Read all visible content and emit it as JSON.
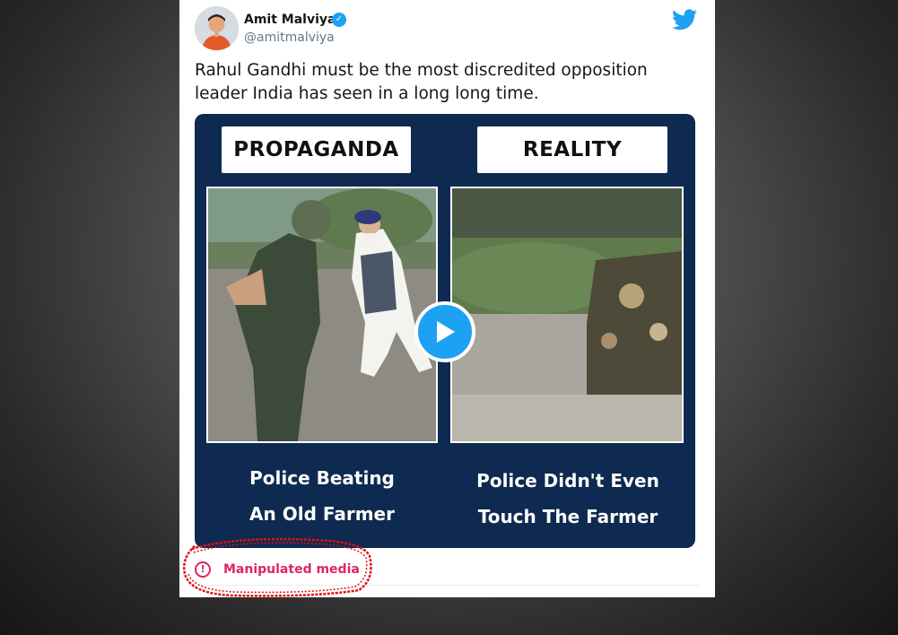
{
  "tweet": {
    "author_name": "Amit Malviya",
    "author_handle": "@amitmalviya",
    "text": "Rahul Gandhi must be the most discredited opposition leader India has seen in a long long time.",
    "verified": true
  },
  "media": {
    "left_label": "PROPAGANDA",
    "right_label": "REALITY",
    "left_caption_line1": "Police Beating",
    "left_caption_line2": "An Old Farmer",
    "right_caption_line1": "Police Didn't Even",
    "right_caption_line2": "Touch The Farmer",
    "background_color": "#0e2a50"
  },
  "warning": {
    "label": "Manipulated media",
    "icon": "exclamation-circle-icon",
    "color": "#e0245e",
    "annotation_color": "#e01010"
  },
  "colors": {
    "twitter_blue": "#1da1f2"
  }
}
